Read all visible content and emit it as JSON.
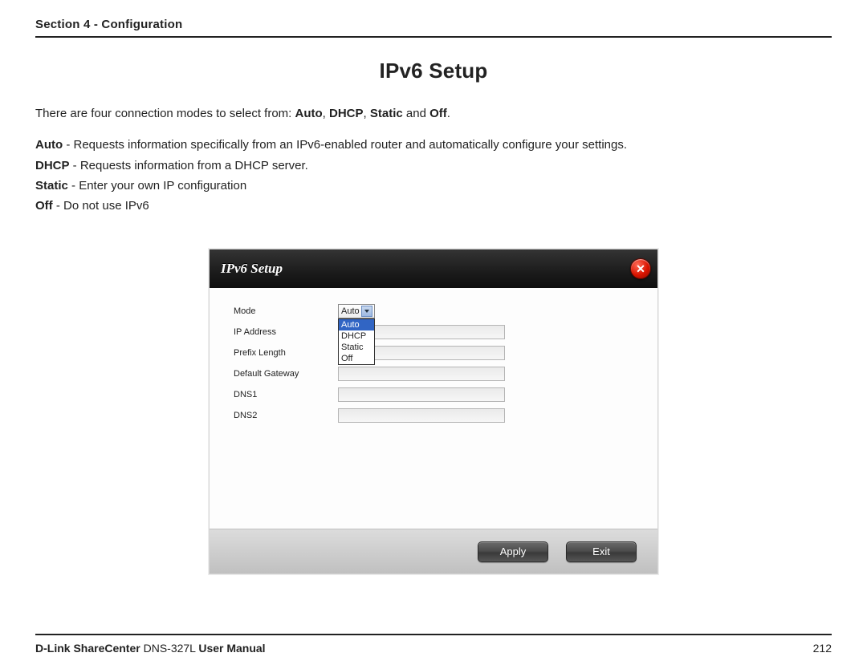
{
  "header": {
    "section_label": "Section 4 - Configuration"
  },
  "title": "IPv6 Setup",
  "intro": {
    "lead_prefix": "There are four connection modes to select from: ",
    "b1": "Auto",
    "c1": ", ",
    "b2": "DHCP",
    "c2": ", ",
    "b3": "Static",
    "c3": " and ",
    "b4": "Off",
    "c4": ".",
    "modes": {
      "auto": {
        "name": "Auto",
        "desc": " - Requests information specifically from an IPv6-enabled router and automatically configure your settings."
      },
      "dhcp": {
        "name": "DHCP",
        "desc": " - Requests information from a DHCP server."
      },
      "static": {
        "name": "Static",
        "desc": " - Enter your own IP configuration"
      },
      "off": {
        "name": "Off",
        "desc": " - Do not use IPv6"
      }
    }
  },
  "dialog": {
    "title": "IPv6 Setup",
    "labels": {
      "mode": "Mode",
      "ip": "IP Address",
      "prefix": "Prefix Length",
      "gateway": "Default Gateway",
      "dns1": "DNS1",
      "dns2": "DNS2"
    },
    "mode_selected": "Auto",
    "mode_options": [
      "Auto",
      "DHCP",
      "Static",
      "Off"
    ],
    "values": {
      "ip": "",
      "prefix": "",
      "gateway": "",
      "dns1": "",
      "dns2": ""
    },
    "buttons": {
      "apply": "Apply",
      "exit": "Exit"
    }
  },
  "footer": {
    "brand_bold1": "D-Link ShareCenter",
    "model": " DNS-327L ",
    "brand_bold2": "User Manual",
    "page": "212"
  }
}
